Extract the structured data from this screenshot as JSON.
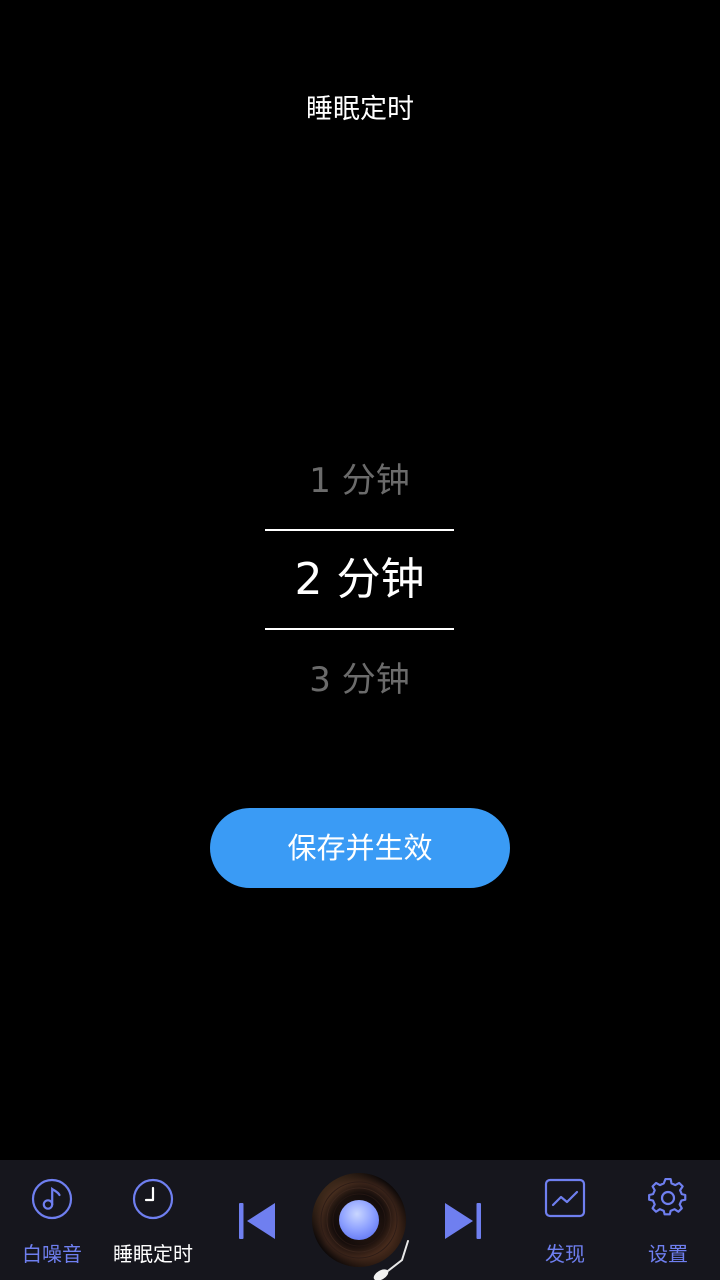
{
  "header": {
    "title": "睡眠定时"
  },
  "picker": {
    "prev_option": "1 分钟",
    "selected_option": "2 分钟",
    "next_option": "3 分钟"
  },
  "actions": {
    "save_label": "保存并生效"
  },
  "bottom_nav": {
    "white_noise_label": "白噪音",
    "sleep_timer_label": "睡眠定时",
    "discover_label": "发现",
    "settings_label": "设置",
    "active_tab": "sleep_timer"
  },
  "icons": {
    "white_noise": "music-note-icon",
    "sleep_timer": "clock-icon",
    "previous": "skip-previous-icon",
    "next": "skip-next-icon",
    "discover": "trend-chart-icon",
    "settings": "gear-icon"
  },
  "colors": {
    "background": "#000000",
    "accent_button": "#3a9bf5",
    "nav_accent": "#6f7ff0",
    "nav_background": "#16161d",
    "picker_dim_text": "#6b6b6b"
  }
}
